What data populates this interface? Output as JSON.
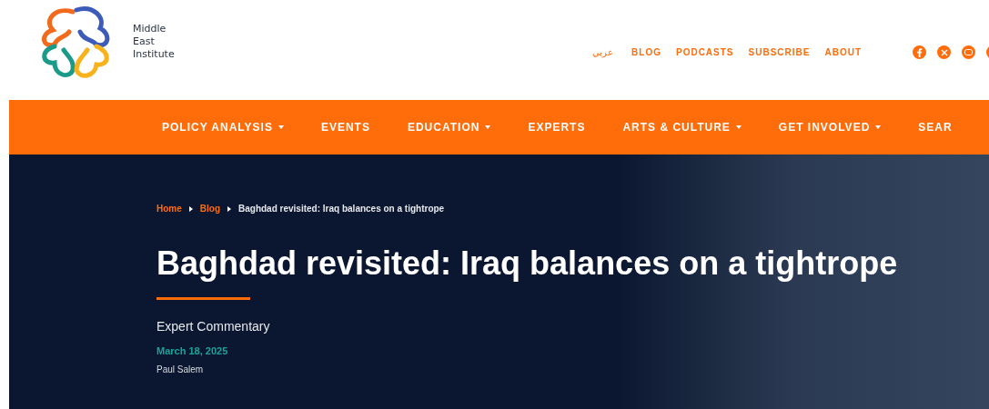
{
  "logo": {
    "text_lines": [
      "Middle",
      "East",
      "Institute"
    ]
  },
  "top_links": [
    {
      "label": "عربي",
      "kind": "arabic"
    },
    {
      "label": "BLOG",
      "kind": "latin"
    },
    {
      "label": "PODCASTS",
      "kind": "latin"
    },
    {
      "label": "SUBSCRIBE",
      "kind": "latin"
    },
    {
      "label": "ABOUT",
      "kind": "latin"
    }
  ],
  "social_icons": [
    {
      "kind": "facebook"
    },
    {
      "kind": "x"
    },
    {
      "kind": "youtube"
    },
    {
      "kind": "partial"
    }
  ],
  "main_nav": [
    {
      "label": "POLICY ANALYSIS",
      "dropdown": true
    },
    {
      "label": "EVENTS",
      "dropdown": false
    },
    {
      "label": "EDUCATION",
      "dropdown": true
    },
    {
      "label": "EXPERTS",
      "dropdown": false
    },
    {
      "label": "ARTS & CULTURE",
      "dropdown": true
    },
    {
      "label": "GET INVOLVED",
      "dropdown": true
    },
    {
      "label": "SEAR",
      "dropdown": false
    }
  ],
  "breadcrumb": [
    {
      "label": "Home",
      "link": true
    },
    {
      "label": "Blog",
      "link": true
    },
    {
      "label": "Baghdad revisited: Iraq balances on a tightrope",
      "link": false
    }
  ],
  "article": {
    "title": "Baghdad revisited: Iraq balances on a tightrope",
    "category": "Expert Commentary",
    "date": "March 18, 2025",
    "author": "Paul Salem"
  }
}
